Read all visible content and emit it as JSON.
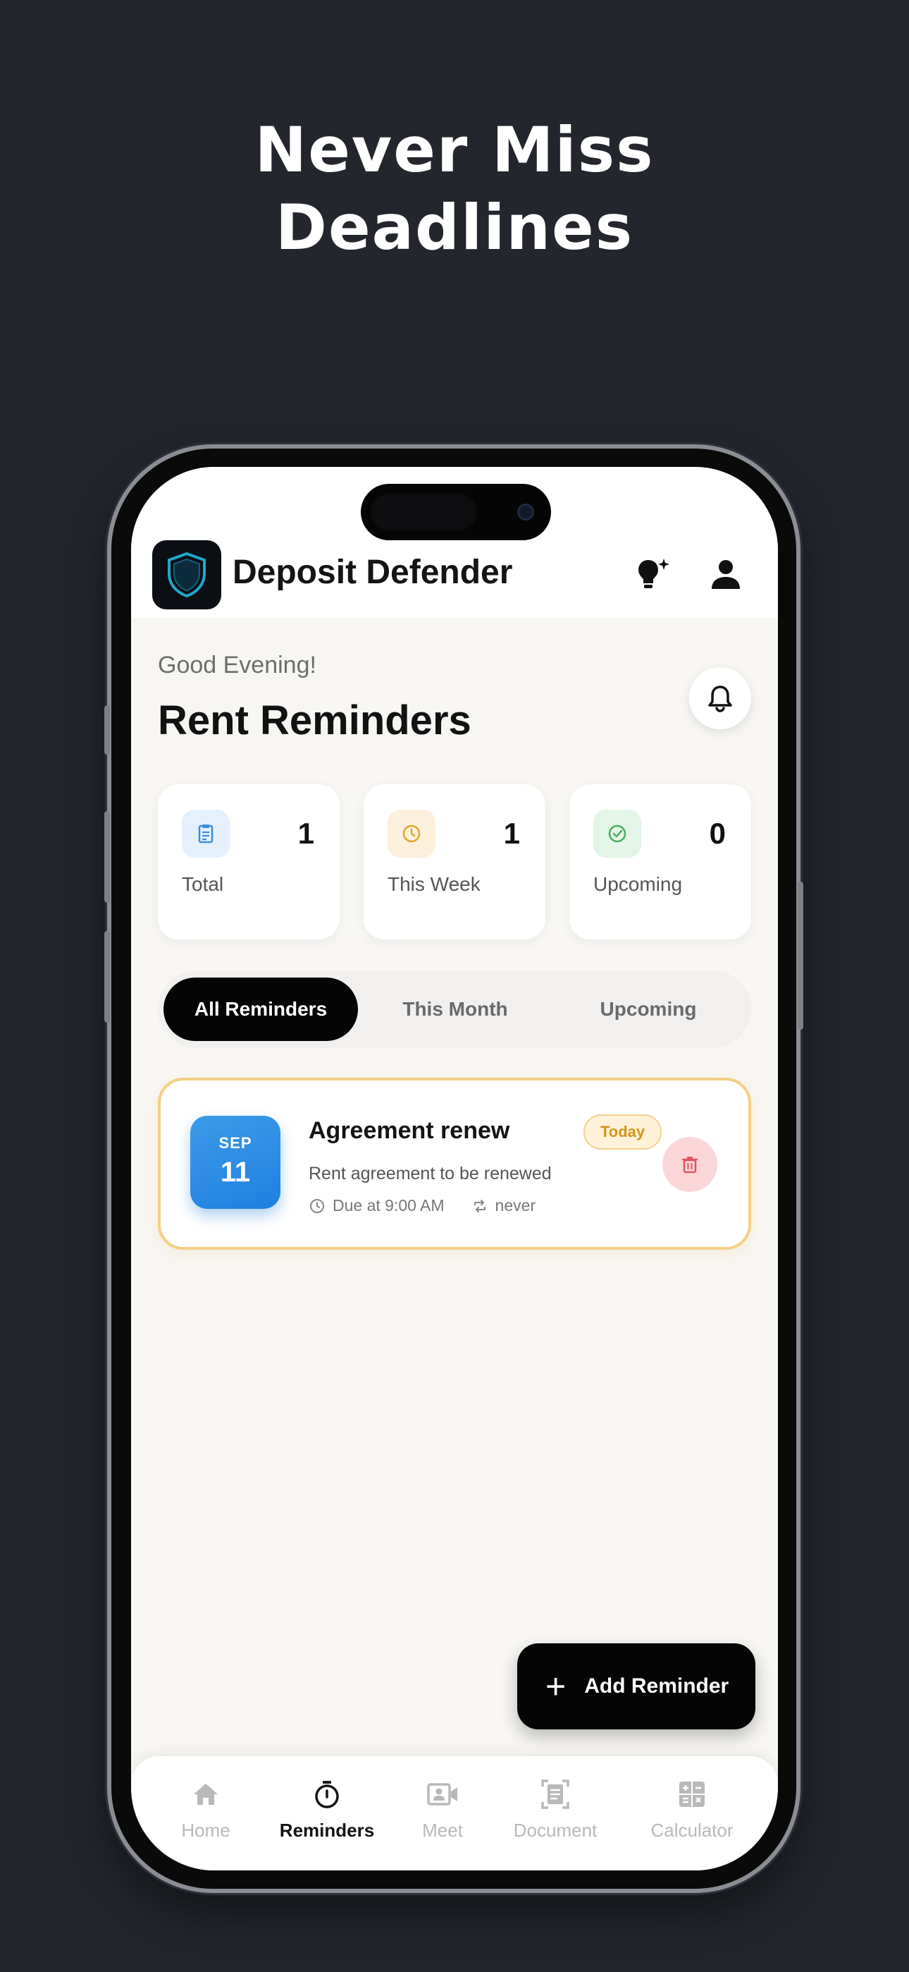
{
  "hero": {
    "line1": "Never Miss",
    "line2": "Deadlines"
  },
  "app": {
    "title": "Deposit Defender"
  },
  "header_icons": {
    "tips": "lightbulb-icon",
    "profile": "person-icon"
  },
  "greeting": "Good Evening!",
  "page_title": "Rent Reminders",
  "stats": [
    {
      "label": "Total",
      "value": "1",
      "icon": "clipboard-icon",
      "color": "#3d8fd6",
      "bg": "#e4f1fc"
    },
    {
      "label": "This Week",
      "value": "1",
      "icon": "clock-icon",
      "color": "#e3a62b",
      "bg": "#fdf0dc"
    },
    {
      "label": "Upcoming",
      "value": "0",
      "icon": "check-circle-icon",
      "color": "#4caf62",
      "bg": "#e3f5e6"
    }
  ],
  "tabs": [
    {
      "label": "All Reminders",
      "active": true
    },
    {
      "label": "This Month",
      "active": false
    },
    {
      "label": "Upcoming",
      "active": false
    }
  ],
  "reminders": [
    {
      "month": "SEP",
      "day": "11",
      "title": "Agreement renew",
      "description": "Rent agreement to be renewed",
      "due": "Due at 9:00 AM",
      "repeat": "never",
      "badge": "Today"
    }
  ],
  "fab": {
    "label": "Add Reminder"
  },
  "nav": [
    {
      "label": "Home",
      "icon": "home-icon",
      "active": false
    },
    {
      "label": "Reminders",
      "icon": "timer-icon",
      "active": true
    },
    {
      "label": "Meet",
      "icon": "video-icon",
      "active": false
    },
    {
      "label": "Document",
      "icon": "document-icon",
      "active": false
    },
    {
      "label": "Calculator",
      "icon": "calculator-icon",
      "active": false
    }
  ],
  "colors": {
    "background": "#23262d",
    "screen": "#f8f6f3",
    "accent_blue": "#1f7fe0",
    "card_border": "#f4cf84",
    "delete": "#e0565f"
  }
}
